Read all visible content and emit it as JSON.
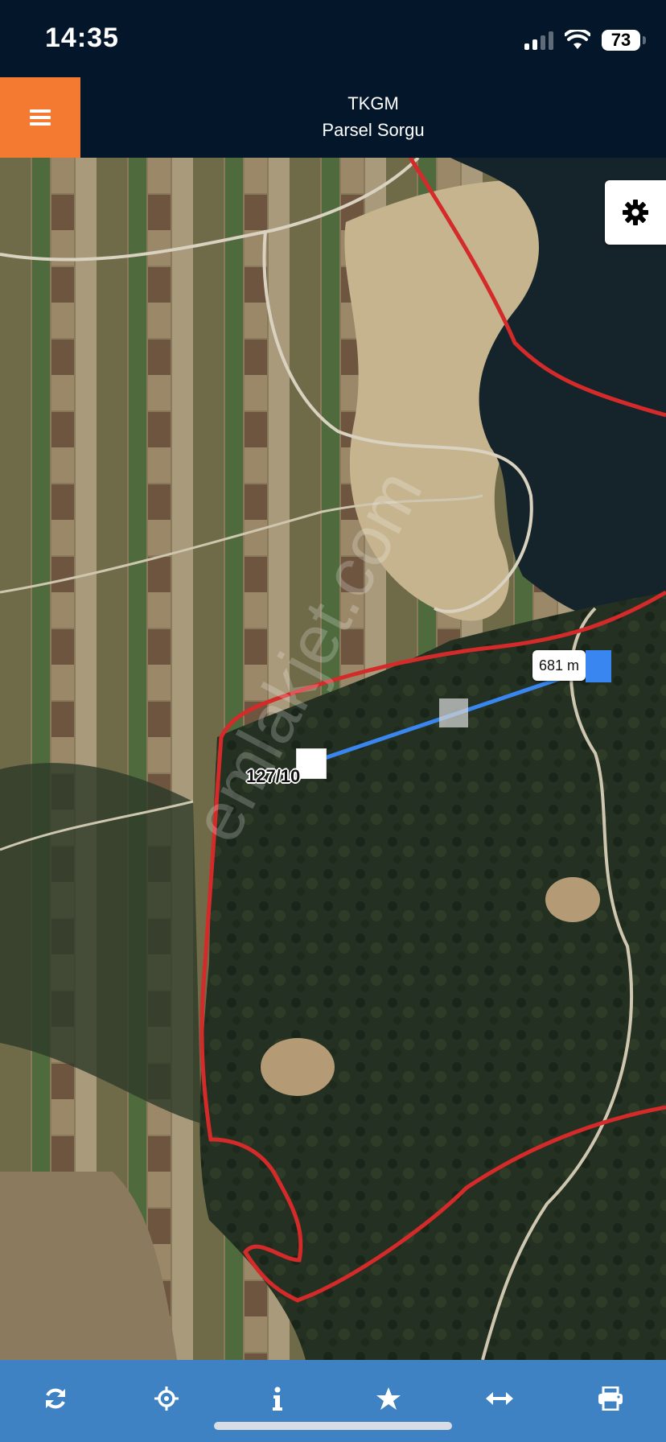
{
  "status_bar": {
    "time": "14:35",
    "battery": "73"
  },
  "header": {
    "title": "TKGM",
    "subtitle": "Parsel Sorgu"
  },
  "map": {
    "distance_label": "681 m",
    "parcel_label": "127/10",
    "watermark": "emlakjet.com",
    "boundary_color": "#d42a2a",
    "measure_color": "#3a86f0"
  },
  "toolbar": {
    "buttons": [
      "refresh-icon",
      "locate-icon",
      "info-icon",
      "favorite-icon",
      "measure-icon",
      "print-icon"
    ]
  }
}
